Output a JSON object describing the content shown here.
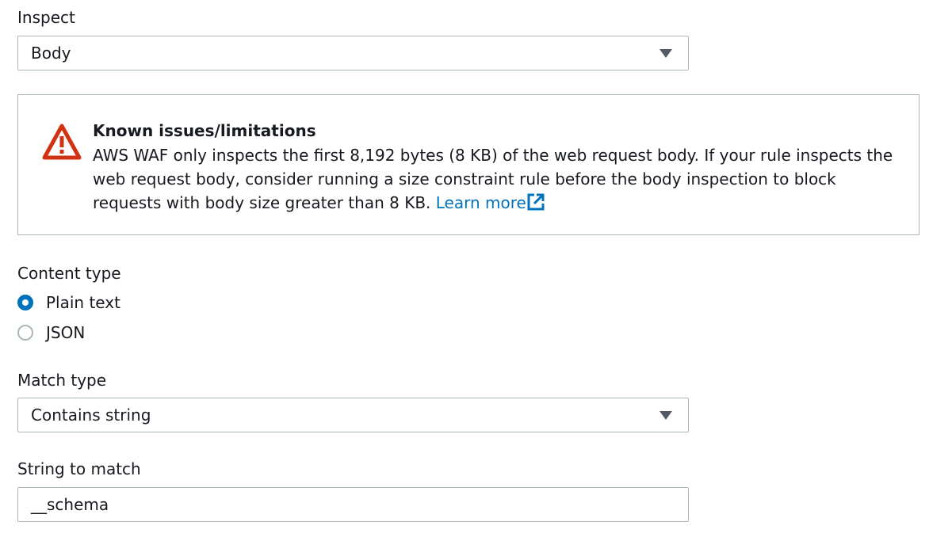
{
  "inspect": {
    "label": "Inspect",
    "selected": "Body"
  },
  "alert": {
    "icon": "warning-icon",
    "title": "Known issues/limitations",
    "body": "AWS WAF only inspects the first 8,192 bytes (8 KB) of the web request body. If your rule inspects the web request body, consider running a size constraint rule before the body inspection to block requests with body size greater than 8 KB.",
    "link_text": "Learn more",
    "link_icon": "external-link-icon",
    "icon_color": "#d13212",
    "link_color": "#0073bb"
  },
  "content_type": {
    "label": "Content type",
    "options": [
      {
        "label": "Plain text",
        "checked": true
      },
      {
        "label": "JSON",
        "checked": false
      }
    ],
    "accent_color": "#0073bb"
  },
  "match_type": {
    "label": "Match type",
    "selected": "Contains string"
  },
  "string_to_match": {
    "label": "String to match",
    "value": "__schema"
  }
}
